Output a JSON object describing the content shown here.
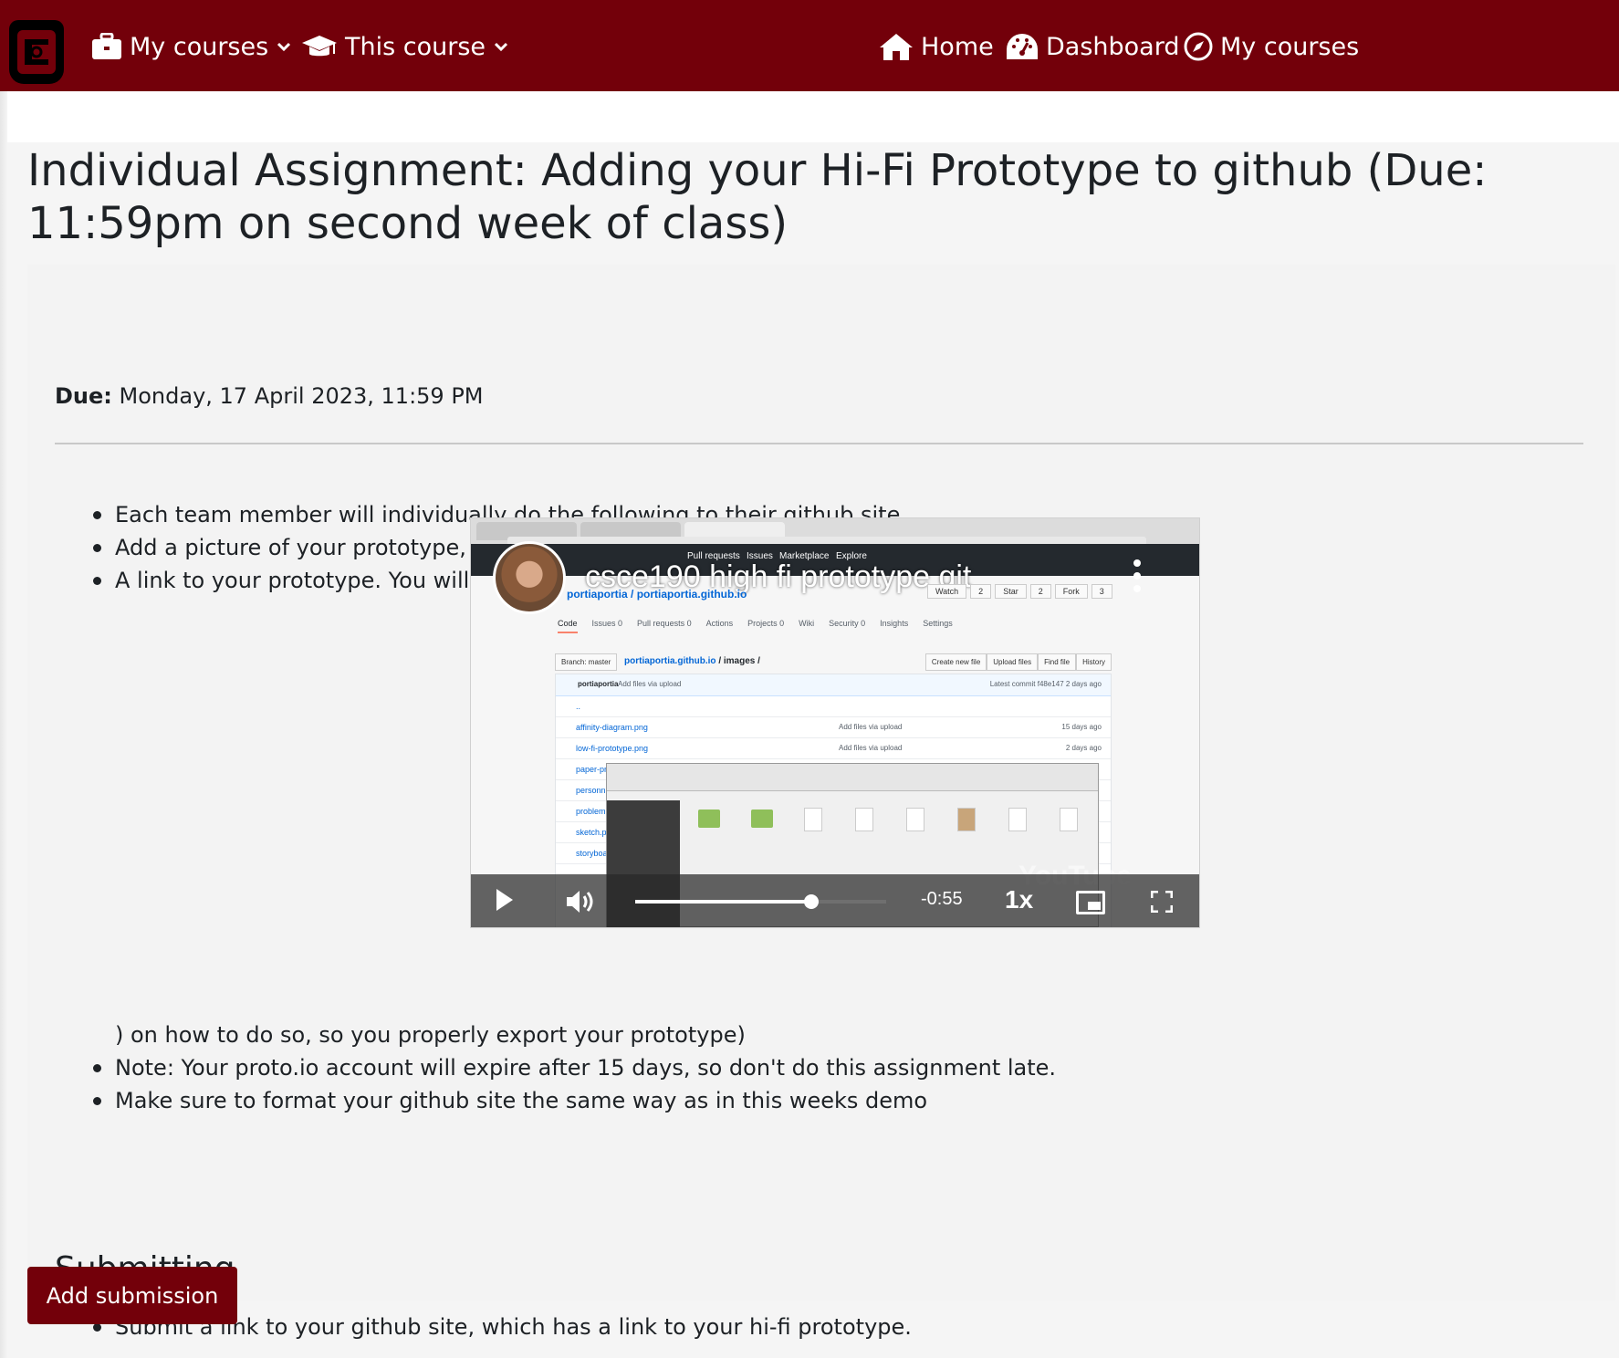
{
  "navbar": {
    "brand_color": "#73000a",
    "left_menu": [
      {
        "label": "My courses",
        "icon": "briefcase-icon"
      },
      {
        "label": "This course",
        "icon": "graduation-cap-icon"
      }
    ],
    "right_menu": [
      {
        "label": "Home",
        "icon": "home-icon"
      },
      {
        "label": "Dashboard",
        "icon": "dashboard-gauge-icon"
      },
      {
        "label": "My courses",
        "icon": "compass-icon"
      }
    ]
  },
  "page": {
    "title": "Individual Assignment: Adding your Hi-Fi Prototype to github (Due: 11:59pm on second week of class)",
    "due_label": "Due:",
    "due_value": "Monday, 17 April 2023, 11:59 PM"
  },
  "instructions": {
    "items": [
      "Each team member will individually do the following to their github site.",
      "Add a picture of your prototype, and",
      "A link to your prototype.  You will have to follow the video ("
    ],
    "after_video": ") on how to do so, so you properly export your prototype)",
    "more_items": [
      "Note: Your proto.io account will expire after 15 days, so don't do this assignment late.",
      "Make sure to format your github site the same way as in this weeks demo"
    ]
  },
  "video": {
    "title": "csce190 high fi prototype git",
    "time_remaining": "-0:55",
    "speed": "1x",
    "progress": 0.7,
    "watermark": "YouTube",
    "github": {
      "nav_links": [
        "Pull requests",
        "Issues",
        "Marketplace",
        "Explore"
      ],
      "repo_owner": "portiaportia",
      "repo_name": "portiaportia.github.io",
      "repo_buttons": [
        "Watch",
        "2",
        "Star",
        "2",
        "Fork",
        "3"
      ],
      "tabs": [
        "Code",
        "Issues 0",
        "Pull requests 0",
        "Actions",
        "Projects 0",
        "Wiki",
        "Security 0",
        "Insights",
        "Settings"
      ],
      "branch": "Branch: master",
      "path_repo": "portiaportia.github.io",
      "path_folder": " / images /",
      "file_buttons": [
        "Create new file",
        "Upload files",
        "Find file",
        "History"
      ],
      "commit_user": "portiaportia",
      "commit_msg": "Add files via upload",
      "latest_commit": "Latest commit f48e147 2 days ago",
      "files": [
        {
          "name": "..",
          "msg": "",
          "age": ""
        },
        {
          "name": "affinity-diagram.png",
          "msg": "Add files via upload",
          "age": "15 days ago"
        },
        {
          "name": "low-fi-prototype.png",
          "msg": "Add files via upload",
          "age": "2 days ago"
        },
        {
          "name": "paper-pr...",
          "msg": "",
          "age": ""
        },
        {
          "name": "personn...",
          "msg": "",
          "age": ""
        },
        {
          "name": "problem...",
          "msg": "",
          "age": ""
        },
        {
          "name": "sketch.p...",
          "msg": "",
          "age": ""
        },
        {
          "name": "storyboa...",
          "msg": "",
          "age": ""
        }
      ]
    }
  },
  "submitting": {
    "heading": "Submitting",
    "items": [
      "Submit a link to your github site, which has a link to your hi-fi prototype."
    ]
  },
  "actions": {
    "add_submission_label": "Add submission"
  }
}
